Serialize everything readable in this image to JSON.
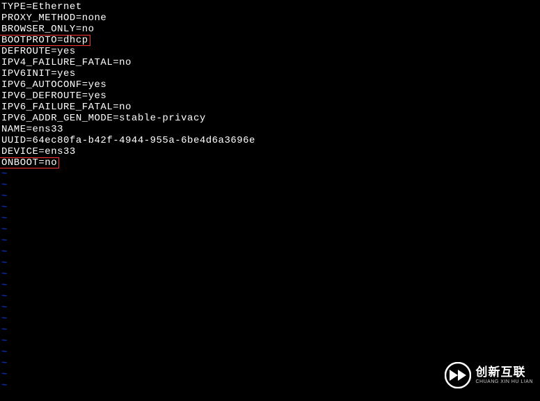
{
  "config": {
    "lines": [
      "TYPE=Ethernet",
      "PROXY_METHOD=none",
      "BROWSER_ONLY=no",
      "BOOTPROTO=dhcp",
      "DEFROUTE=yes",
      "IPV4_FAILURE_FATAL=no",
      "IPV6INIT=yes",
      "IPV6_AUTOCONF=yes",
      "IPV6_DEFROUTE=yes",
      "IPV6_FAILURE_FATAL=no",
      "IPV6_ADDR_GEN_MODE=stable-privacy",
      "NAME=ens33",
      "UUID=64ec80fa-b42f-4944-955a-6be4d6a3696e",
      "DEVICE=ens33",
      "ONBOOT=no"
    ],
    "highlighted_indices": [
      3,
      14
    ],
    "tilde": "~",
    "tilde_count": 20
  },
  "watermark": {
    "cn": "创新互联",
    "en": "CHUANG XIN HU LIAN"
  }
}
